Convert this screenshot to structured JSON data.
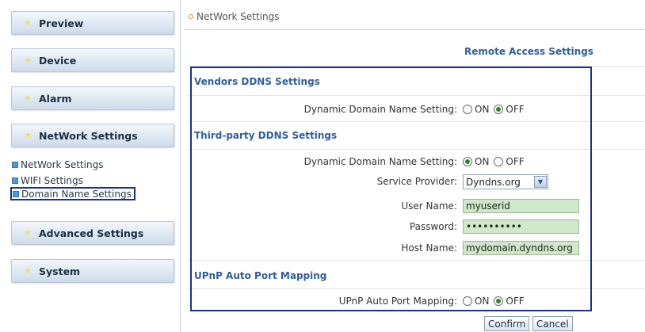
{
  "sidebar": {
    "sections": [
      {
        "label": "Preview"
      },
      {
        "label": "Device"
      },
      {
        "label": "Alarm"
      },
      {
        "label": "NetWork Settings"
      },
      {
        "label": "Advanced Settings"
      },
      {
        "label": "System"
      }
    ],
    "subitems": [
      {
        "label": "NetWork Settings"
      },
      {
        "label": "WIFI Settings"
      },
      {
        "label": "Domain Name Settings",
        "selected": true
      }
    ]
  },
  "breadcrumb": "NetWork Settings",
  "panel_title": "Remote Access Settings",
  "vendors": {
    "title": "Vendors DDNS Settings",
    "ddns_label": "Dynamic Domain Name Setting:",
    "ddns_value": "OFF"
  },
  "third_party": {
    "title": "Third-party DDNS Settings",
    "ddns_label": "Dynamic Domain Name Setting:",
    "ddns_value": "ON",
    "provider_label": "Service Provider:",
    "provider_value": "Dyndns.org",
    "username_label": "User Name:",
    "username_value": "myuserid",
    "password_label": "Password:",
    "password_value": "••••••••••",
    "hostname_label": "Host Name:",
    "hostname_value": "mydomain.dyndns.org"
  },
  "upnp": {
    "title": "UPnP Auto Port Mapping",
    "label": "UPnP Auto Port Mapping:",
    "value": "OFF"
  },
  "radio_labels": {
    "on": "ON",
    "off": "OFF"
  },
  "buttons": {
    "confirm": "Confirm",
    "cancel": "Cancel"
  },
  "colors": {
    "accent": "#2f5f9e",
    "highlight_frame": "#1c2e9a",
    "input_fill": "#cfe8c8"
  }
}
